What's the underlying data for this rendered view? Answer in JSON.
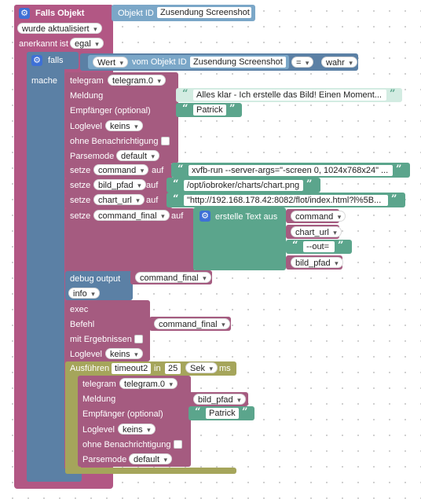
{
  "colors": {
    "event": "#b25784",
    "event_dark": "#8c4068",
    "control": "#5b80a5",
    "logic": "#5b80a5",
    "telegram": "#a55b80",
    "variables": "#a55b80",
    "text": "#5ba58c",
    "timeout": "#a5a55b",
    "debug": "#5b80a5",
    "objid": "#7ba7c8"
  },
  "trigger": {
    "title": "Falls Objekt",
    "object_id_label": "Objekt ID",
    "object_id_value": "Zusendung Screenshot",
    "updated_option": "wurde aktualisiert",
    "ack_label": "anerkannt ist",
    "ack_value": "egal"
  },
  "if_block": {
    "if_label": "falls",
    "then_label": "mache",
    "value_option": "Wert",
    "from_object_label": "vom Objekt ID",
    "object_value": "Zusendung Screenshot",
    "operator": "=",
    "compare_value": "wahr"
  },
  "telegram1": {
    "title": "telegram",
    "instance": "telegram.0",
    "message_label": "Meldung",
    "message_text": "Alles klar - Ich erstelle das Bild! Einen Moment...",
    "recipient_label": "Empfänger (optional)",
    "recipient_text": "Patrick",
    "loglevel_label": "Loglevel",
    "loglevel_value": "keins",
    "silent_label": "ohne Benachrichtigung",
    "parsemode_label": "Parsemode",
    "parsemode_value": "default"
  },
  "set1": {
    "set_label": "setze",
    "var": "command",
    "to_label": "auf",
    "text": "xvfb-run --server-args=\"-screen 0, 1024x768x24\" ..."
  },
  "set2": {
    "set_label": "setze",
    "var": "bild_pfad",
    "to_label": "auf",
    "text": "/opt/iobroker/charts/chart.png"
  },
  "set3": {
    "set_label": "setze",
    "var": "chart_url",
    "to_label": "auf",
    "text": "\"http://192.168.178.42:8082/flot/index.html?l%5B..."
  },
  "set4": {
    "set_label": "setze",
    "var": "command_final",
    "to_label": "auf",
    "join_label": "erstelle Text aus",
    "parts": [
      "command",
      "chart_url",
      "--out=",
      "bild_pfad"
    ]
  },
  "debug": {
    "label": "debug output",
    "var": "command_final",
    "level": "info"
  },
  "exec": {
    "title": "exec",
    "command_label": "Befehl",
    "command_var": "command_final",
    "results_label": "mit Ergebnissen",
    "loglevel_label": "Loglevel",
    "loglevel_value": "keins"
  },
  "timeout": {
    "run_label": "Ausführen",
    "name": "timeout2",
    "in_label": "in",
    "value": "25",
    "unit": "Sek",
    "ms_label": "ms"
  },
  "telegram2": {
    "title": "telegram",
    "instance": "telegram.0",
    "message_label": "Meldung",
    "message_var": "bild_pfad",
    "recipient_label": "Empfänger (optional)",
    "recipient_text": "Patrick",
    "loglevel_label": "Loglevel",
    "loglevel_value": "keins",
    "silent_label": "ohne Benachrichtigung",
    "parsemode_label": "Parsemode",
    "parsemode_value": "default"
  }
}
